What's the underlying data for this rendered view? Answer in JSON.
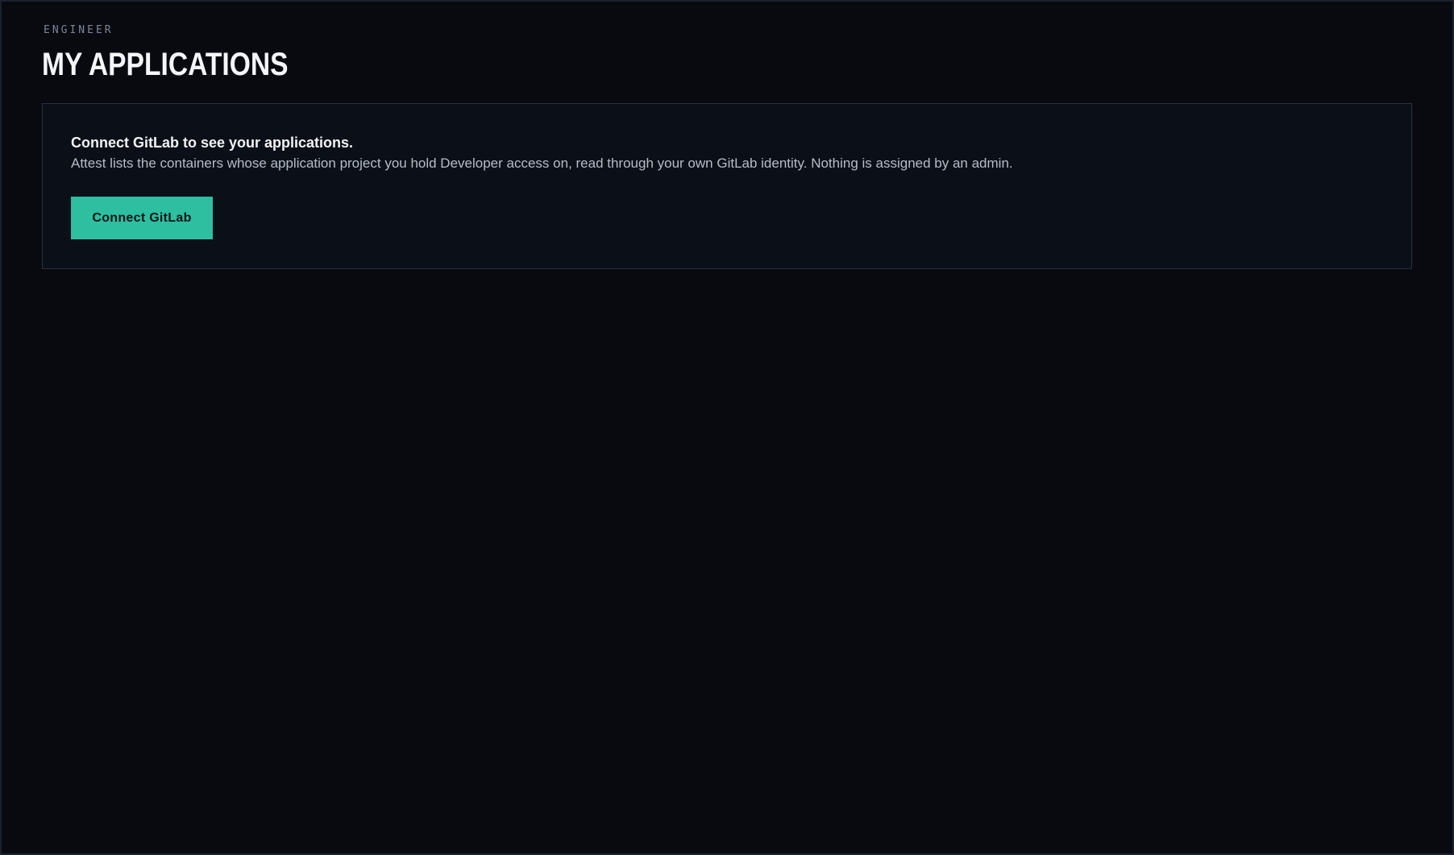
{
  "header": {
    "eyebrow": "ENGINEER",
    "title": "MY APPLICATIONS"
  },
  "connect_card": {
    "heading": "Connect GitLab to see your applications.",
    "body": "Attest lists the containers whose application project you hold Developer access on, read through your own GitLab identity. Nothing is assigned by an admin.",
    "button_label": "Connect GitLab"
  },
  "colors": {
    "background": "#080a10",
    "card_background": "#0b0f17",
    "card_border": "#2a3040",
    "accent": "#2dbfa0",
    "heading_text": "#f4f6fa",
    "muted_text": "#7d8596"
  }
}
